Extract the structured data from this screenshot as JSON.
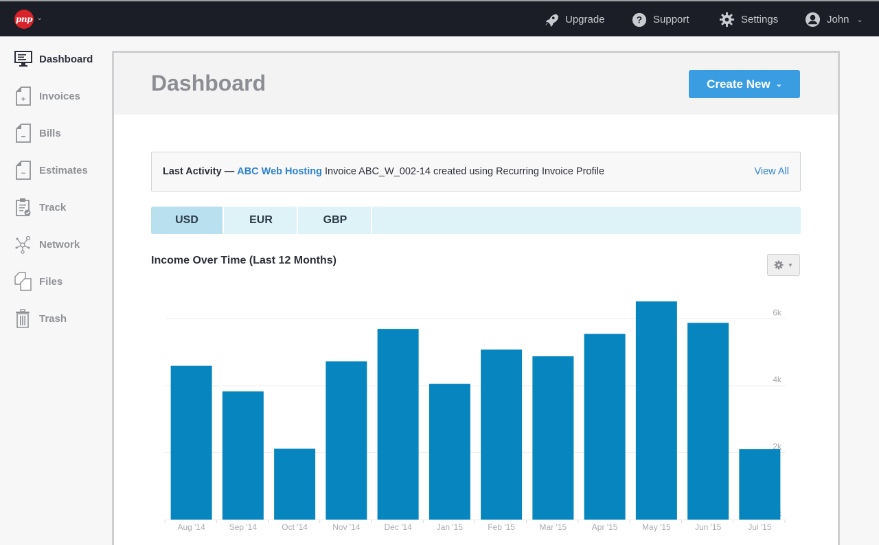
{
  "app": {
    "logo_text": "pnp"
  },
  "topnav": {
    "items": [
      {
        "label": "Upgrade",
        "icon": "rocket-icon"
      },
      {
        "label": "Support",
        "icon": "question-circle-icon"
      },
      {
        "label": "Settings",
        "icon": "gear-icon"
      },
      {
        "label": "John",
        "icon": "user-avatar-icon"
      }
    ]
  },
  "sidebar": {
    "items": [
      {
        "label": "Dashboard",
        "icon": "monitor-icon",
        "active": true
      },
      {
        "label": "Invoices",
        "icon": "document-plus-icon"
      },
      {
        "label": "Bills",
        "icon": "document-minus-icon"
      },
      {
        "label": "Estimates",
        "icon": "document-tilde-icon"
      },
      {
        "label": "Track",
        "icon": "clipboard-check-icon"
      },
      {
        "label": "Network",
        "icon": "network-icon"
      },
      {
        "label": "Files",
        "icon": "files-icon"
      },
      {
        "label": "Trash",
        "icon": "trash-icon"
      }
    ]
  },
  "main": {
    "title": "Dashboard",
    "create_button": "Create New",
    "activity": {
      "label": "Last Activity —",
      "link": "ABC Web Hosting",
      "text": "Invoice ABC_W_002-14 created using Recurring Invoice Profile",
      "view_all": "View All"
    },
    "currency_tabs": [
      {
        "label": "USD",
        "active": true
      },
      {
        "label": "EUR"
      },
      {
        "label": "GBP"
      }
    ]
  },
  "colors": {
    "bar": "#0785bf",
    "accent": "#3a9de2",
    "link": "#2f82d0",
    "topbar": "#1b1e26"
  },
  "chart_data": {
    "type": "bar",
    "title": "Income Over Time (Last 12 Months)",
    "xlabel": "",
    "ylabel": "",
    "categories": [
      "Aug '14",
      "Sep '14",
      "Oct '14",
      "Nov '14",
      "Dec '14",
      "Jan '15",
      "Feb '15",
      "Mar '15",
      "Apr '15",
      "May '15",
      "Jun '15",
      "Jul '15"
    ],
    "values": [
      4600,
      3830,
      2120,
      4730,
      5700,
      4060,
      5080,
      4880,
      5550,
      6520,
      5880,
      2110
    ],
    "ylim": [
      0,
      6520
    ],
    "yticks": [
      0,
      2000,
      4000,
      6000
    ],
    "ytick_labels": [
      "0k",
      "2k",
      "4k",
      "6k"
    ],
    "y_axis_side": "right",
    "grid": true,
    "legend": "none"
  }
}
